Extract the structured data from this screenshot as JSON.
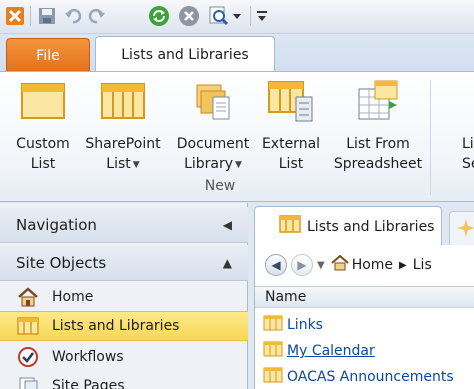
{
  "quick_access": {
    "items": [
      "app-logo",
      "save",
      "undo",
      "redo",
      "refresh",
      "stop",
      "preview",
      "customize"
    ]
  },
  "tabs": {
    "file": "File",
    "lists_and_libraries": "Lists and Libraries"
  },
  "ribbon": {
    "buttons": [
      {
        "line1": "Custom",
        "line2": "List",
        "dropdown": false
      },
      {
        "line1": "SharePoint",
        "line2": "List",
        "dropdown": true
      },
      {
        "line1": "Document",
        "line2": "Library",
        "dropdown": true
      },
      {
        "line1": "External",
        "line2": "List",
        "dropdown": false
      },
      {
        "line1": "List From",
        "line2": "Spreadsheet",
        "dropdown": false
      },
      {
        "line1": "Li",
        "line2": "Sett",
        "dropdown": false
      }
    ],
    "group_label": "New"
  },
  "navigation": {
    "header": "Navigation",
    "section": "Site Objects",
    "items": [
      {
        "label": "Home",
        "icon": "home-icon",
        "selected": false
      },
      {
        "label": "Lists and Libraries",
        "icon": "list-icon",
        "selected": true
      },
      {
        "label": "Workflows",
        "icon": "workflow-icon",
        "selected": false
      },
      {
        "label": "Site Pages",
        "icon": "page-icon",
        "selected": false
      }
    ]
  },
  "document": {
    "tab_label": "Lists and Libraries",
    "breadcrumb": {
      "home": "Home",
      "current": "Lis"
    },
    "column_header": "Name",
    "rows": [
      "Links",
      "My Calendar",
      "OACAS Announcements"
    ]
  },
  "colors": {
    "file_tab": "#e4701c",
    "selected_nav": "#f8d755",
    "link": "#0b49a4"
  }
}
